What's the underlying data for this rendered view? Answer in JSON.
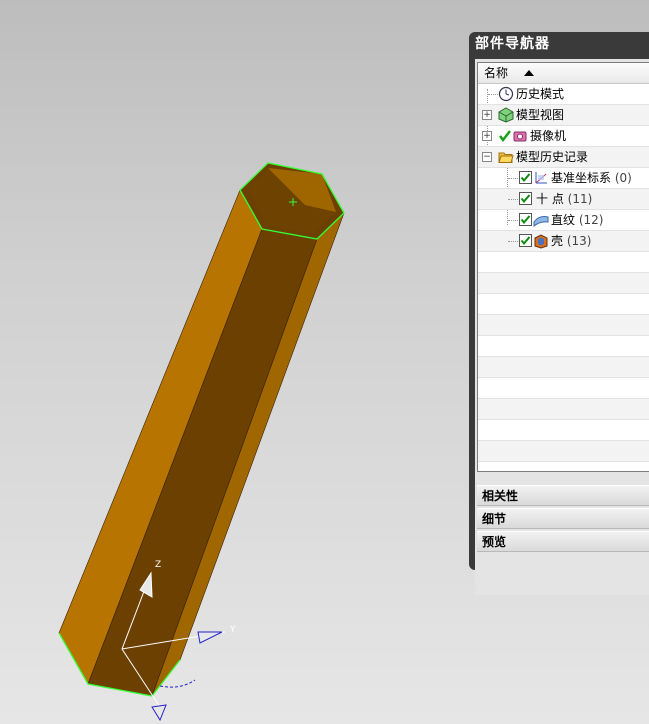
{
  "navigator": {
    "title": "部件导航器",
    "column_header": "名称",
    "tree": [
      {
        "label": "历史模式",
        "icon": "clock-icon"
      },
      {
        "label": "模型视图",
        "icon": "model-view-cube-icon"
      },
      {
        "label": "摄像机",
        "icon": "camera-icon"
      },
      {
        "label": "模型历史记录",
        "icon": "open-folder-icon"
      },
      {
        "label": "基准坐标系",
        "count": "(0)",
        "icon": "datum-csys-icon",
        "checked": true
      },
      {
        "label": "十 点",
        "count": "(11)",
        "icon": "point-icon",
        "checked": true
      },
      {
        "label": "直纹",
        "count": "(12)",
        "icon": "ruled-surface-icon",
        "checked": true
      },
      {
        "label": "壳",
        "count": "(13)",
        "icon": "shell-icon",
        "checked": true
      }
    ],
    "sections": [
      "相关性",
      "细节",
      "预览"
    ]
  },
  "viewport": {
    "axis_labels": {
      "z": "Z",
      "y": "Y"
    },
    "colors": {
      "face_light": "#b87400",
      "face_dark": "#6b4000",
      "edge_highlight": "#33ff33"
    }
  }
}
